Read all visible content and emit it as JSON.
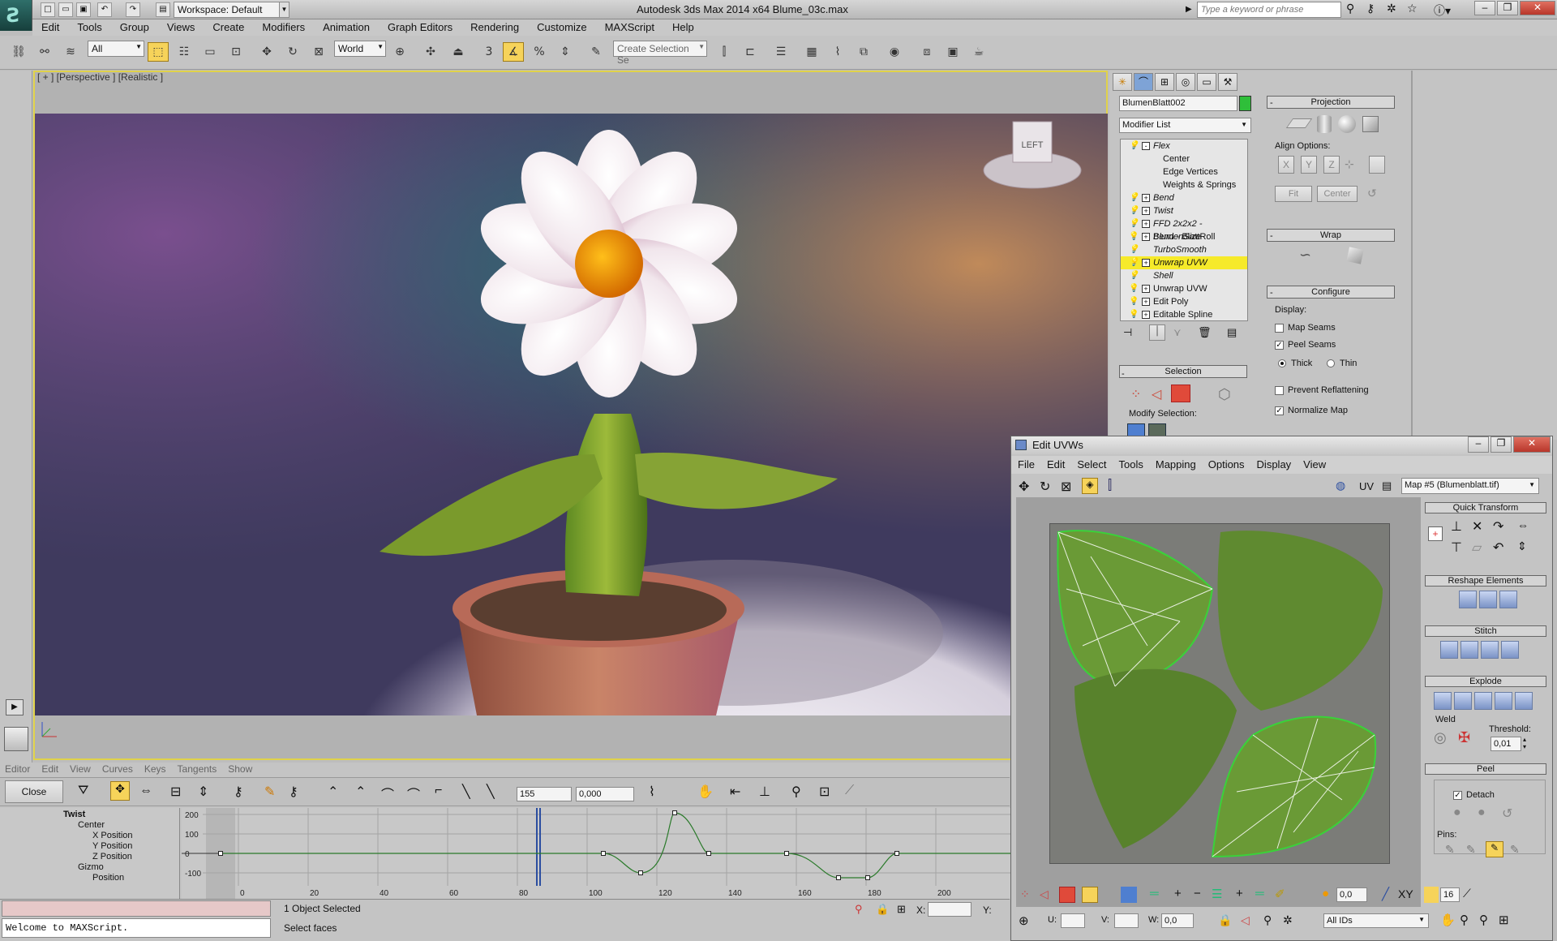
{
  "app": {
    "workspace": "Workspace: Default",
    "title": "Autodesk 3ds Max  2014 x64      Blume_03c.max",
    "search_placeholder": "Type a keyword or phrase"
  },
  "menu": [
    "Edit",
    "Tools",
    "Group",
    "Views",
    "Create",
    "Modifiers",
    "Animation",
    "Graph Editors",
    "Rendering",
    "Customize",
    "MAXScript",
    "Help"
  ],
  "toolbar": {
    "filter": "All",
    "coord": "World",
    "selection_set": "Create Selection Se"
  },
  "viewport": {
    "label": "[ + ] [Perspective ] [Realistic ]",
    "viewcube": "LEFT"
  },
  "modify": {
    "object_name": "BlumenBlatt002",
    "modifier_list": "Modifier List",
    "stack": [
      {
        "label": "Flex",
        "italic": true,
        "expand": "-",
        "sub": false,
        "selected": false
      },
      {
        "label": "Center",
        "italic": false,
        "expand": "",
        "sub": true,
        "selected": false
      },
      {
        "label": "Edge Vertices",
        "italic": false,
        "expand": "",
        "sub": true,
        "selected": false
      },
      {
        "label": "Weights & Springs",
        "italic": false,
        "expand": "",
        "sub": true,
        "selected": false
      },
      {
        "label": "Bend",
        "italic": true,
        "expand": "+",
        "sub": false,
        "selected": false
      },
      {
        "label": "Twist",
        "italic": true,
        "expand": "+",
        "sub": false,
        "selected": false
      },
      {
        "label": "FFD 2x2x2 - BlumenSize",
        "italic": true,
        "expand": "+",
        "sub": false,
        "selected": false
      },
      {
        "label": "Bend - BlattRoll",
        "italic": false,
        "expand": "+",
        "sub": false,
        "selected": false
      },
      {
        "label": "TurboSmooth",
        "italic": true,
        "expand": "",
        "sub": false,
        "selected": false
      },
      {
        "label": "Unwrap UVW",
        "italic": true,
        "expand": "+",
        "sub": false,
        "selected": true
      },
      {
        "label": "Shell",
        "italic": true,
        "expand": "",
        "sub": false,
        "selected": false
      },
      {
        "label": "Unwrap UVW",
        "italic": false,
        "expand": "+",
        "sub": false,
        "selected": false
      },
      {
        "label": "Edit Poly",
        "italic": false,
        "expand": "+",
        "sub": false,
        "selected": false
      },
      {
        "label": "Editable Spline",
        "italic": false,
        "expand": "+",
        "sub": false,
        "selected": false
      }
    ],
    "selection_head": "Selection",
    "modify_selection": "Modify Selection:",
    "accent_green": "#2fbf3a"
  },
  "projection": {
    "head": "Projection",
    "align_options": "Align Options:",
    "axes": [
      "X",
      "Y",
      "Z"
    ],
    "fit": "Fit",
    "center": "Center",
    "wrap_head": "Wrap",
    "configure_head": "Configure",
    "display": "Display:",
    "map_seams": "Map Seams",
    "peel_seams": "Peel Seams",
    "thick": "Thick",
    "thin": "Thin",
    "prevent": "Prevent Reflattening",
    "normalize": "Normalize Map"
  },
  "uvw": {
    "title": "Edit UVWs",
    "menu": [
      "File",
      "Edit",
      "Select",
      "Tools",
      "Mapping",
      "Options",
      "Display",
      "View"
    ],
    "uv": "UV",
    "map": "Map #5 (Blumenblatt.tif)",
    "quick_transform": "Quick Transform",
    "reshape": "Reshape Elements",
    "stitch": "Stitch",
    "explode": "Explode",
    "weld": "Weld",
    "threshold": "Threshold:",
    "threshold_val": "0,01",
    "peel": "Peel",
    "detach": "Detach",
    "pins": "Pins:",
    "bottom_val": "0,0",
    "u": "U:",
    "v": "V:",
    "w": "W:",
    "w_val": "0,0",
    "xy": "XY",
    "num16": "16",
    "all_ids": "All IDs"
  },
  "curves": {
    "menu": [
      "Editor",
      "Edit",
      "View",
      "Curves",
      "Keys",
      "Tangents",
      "Show"
    ],
    "close": "Close",
    "frame": "155",
    "value": "0,000",
    "tree": [
      {
        "label": "Twist",
        "indent": 0
      },
      {
        "label": "Center",
        "indent": 1
      },
      {
        "label": "X Position",
        "indent": 2
      },
      {
        "label": "Y Position",
        "indent": 2
      },
      {
        "label": "Z Position",
        "indent": 2
      },
      {
        "label": "Gizmo",
        "indent": 1
      },
      {
        "label": "Position",
        "indent": 2
      }
    ],
    "y_ticks": [
      "200",
      "100",
      "0",
      "-100"
    ],
    "x_ticks": [
      "0",
      "20",
      "40",
      "60",
      "80",
      "100",
      "120",
      "140",
      "160",
      "180",
      "200"
    ]
  },
  "status": {
    "maxscript": "Welcome to MAXScript.",
    "selected": "1 Object Selected",
    "prompt": "Select faces",
    "x": "X:",
    "y": "Y:"
  }
}
